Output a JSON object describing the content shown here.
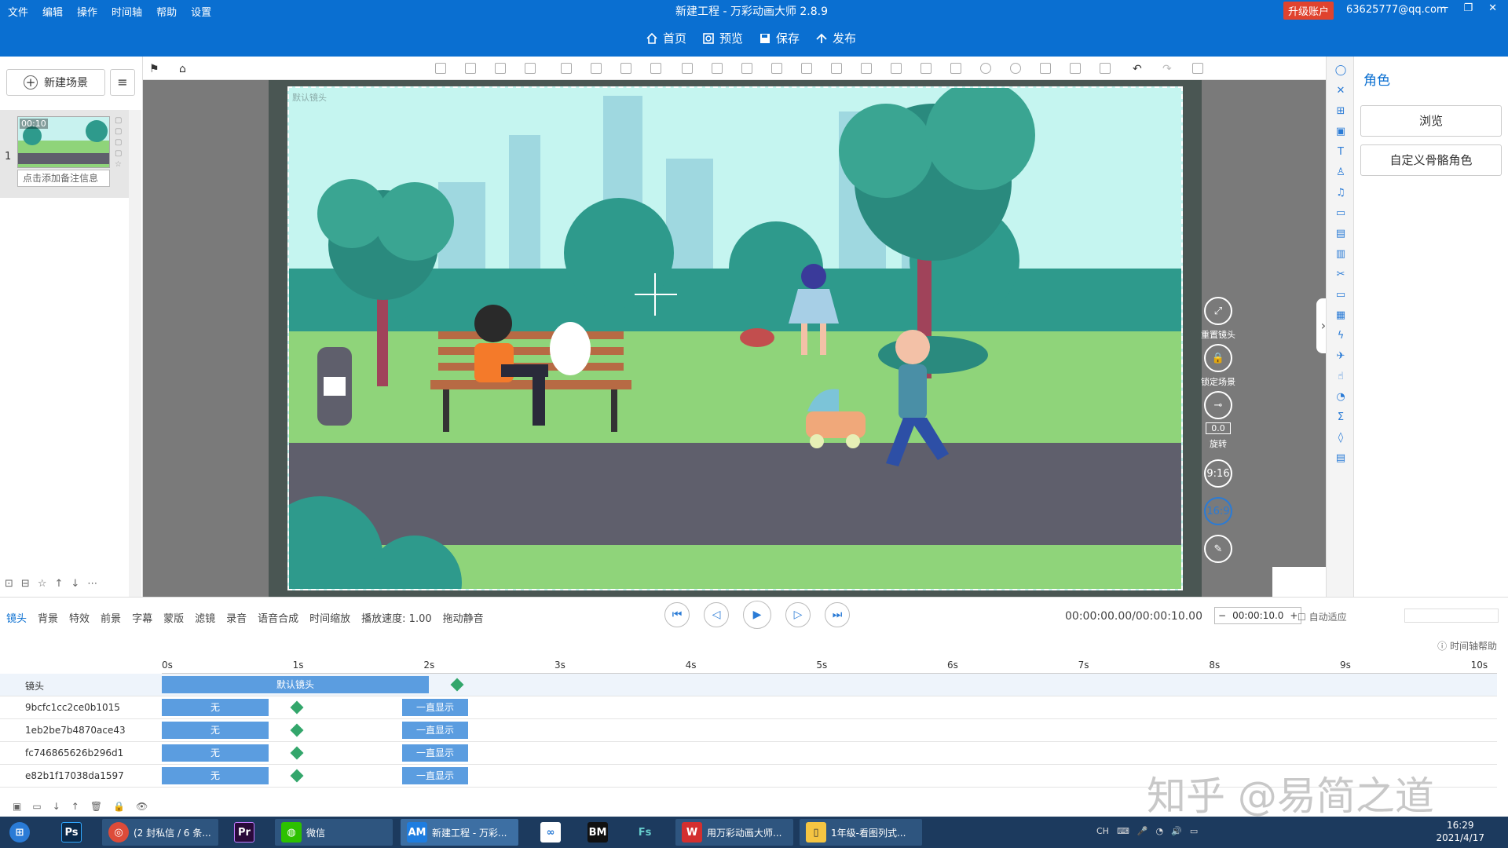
{
  "titlebar": {
    "menus": [
      "文件",
      "编辑",
      "操作",
      "时间轴",
      "帮助",
      "设置"
    ],
    "title": "新建工程 - 万彩动画大师 2.8.9",
    "upgrade": "升级账户",
    "account": "63625777@qq.com",
    "nav": [
      {
        "label": "首页",
        "icon": "home-icon"
      },
      {
        "label": "预览",
        "icon": "preview-icon"
      },
      {
        "label": "保存",
        "icon": "save-icon"
      },
      {
        "label": "发布",
        "icon": "publish-icon"
      }
    ]
  },
  "leftpanel": {
    "new_scene": "新建场景",
    "scene_index": "1",
    "scene_time": "00:10",
    "scene_note": "点击添加备注信息"
  },
  "stage": {
    "camera_label": "默认镜头",
    "controls": [
      {
        "label": "重置镜头",
        "icon": "reset-camera-icon"
      },
      {
        "label": "锁定场景",
        "icon": "lock-scene-icon"
      },
      {
        "label": "旋转",
        "icon": "rotate-icon"
      }
    ],
    "rotate_value": "0.0",
    "ratio_916": "9:16",
    "ratio_169": "16:9"
  },
  "rightpanel": {
    "title": "角色",
    "browse": "浏览",
    "custom_bone": "自定义骨骼角色"
  },
  "timeline": {
    "tools": [
      "镜头",
      "背景",
      "特效",
      "前景",
      "字幕",
      "蒙版",
      "滤镜",
      "录音",
      "语音合成",
      "时间缩放",
      "播放速度: 1.00",
      "拖动静音"
    ],
    "timecode": "00:00:00.00/00:00:10.00",
    "duration": "00:00:10.0",
    "autofit": "自动适应",
    "help": "时间轴帮助",
    "ruler": [
      "0s",
      "1s",
      "2s",
      "3s",
      "4s",
      "5s",
      "6s",
      "7s",
      "8s",
      "9s",
      "10s"
    ],
    "camera_track": {
      "name": "镜头",
      "bar": "默认镜头"
    },
    "tracks": [
      {
        "name": "9bcfc1cc2ce0b1015",
        "bar_in": "无",
        "bar_out": "一直显示"
      },
      {
        "name": "1eb2be7b4870ace43",
        "bar_in": "无",
        "bar_out": "一直显示"
      },
      {
        "name": "fc746865626b296d1",
        "bar_in": "无",
        "bar_out": "一直显示"
      },
      {
        "name": "e82b1f17038da1597",
        "bar_in": "无",
        "bar_out": "一直显示"
      }
    ]
  },
  "watermark": "知乎 @易简之道",
  "taskbar": {
    "items": [
      {
        "label": "",
        "icon": "windows-start-icon"
      },
      {
        "label": "",
        "icon": "photoshop-icon",
        "abbr": "Ps"
      },
      {
        "label": "(2 封私信 / 6 条...",
        "icon": "chrome-icon"
      },
      {
        "label": "",
        "icon": "premiere-icon",
        "abbr": "Pr"
      },
      {
        "label": "微信",
        "icon": "wechat-icon"
      },
      {
        "label": "新建工程 - 万彩...",
        "icon": "animiz-icon",
        "abbr": "AM"
      },
      {
        "label": "",
        "icon": "baidu-netdisk-icon"
      },
      {
        "label": "",
        "icon": "bm-icon",
        "abbr": "BM"
      },
      {
        "label": "",
        "icon": "fs-icon",
        "abbr": "Fs"
      },
      {
        "label": "用万彩动画大师...",
        "icon": "wps-icon"
      },
      {
        "label": "1年级-看图列式...",
        "icon": "folder-icon"
      }
    ],
    "time": "16:29",
    "date": "2021/4/17",
    "ime": "CH"
  },
  "colors": {
    "accent": "#0a6fd1",
    "bar": "#5b9de0",
    "keyframe": "#33a66b"
  }
}
